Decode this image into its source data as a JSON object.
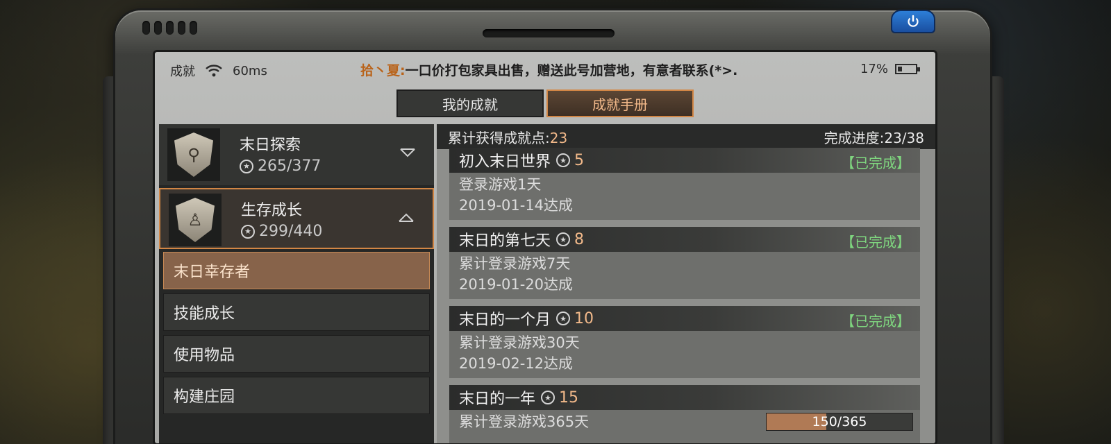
{
  "status_bar": {
    "left_label": "成就",
    "ping": "60ms",
    "broadcast_name": "拾丶夏:",
    "broadcast_text": "一口价打包家具出售，赠送此号加营地，有意者联系(*>.",
    "battery": "17%"
  },
  "tabs": [
    {
      "label": "我的成就",
      "active": false
    },
    {
      "label": "成就手册",
      "active": true
    }
  ],
  "categories": [
    {
      "title": "末日探索",
      "points": "265/377",
      "icon": "binoculars-shield-icon",
      "expanded": false
    },
    {
      "title": "生存成长",
      "points": "299/440",
      "icon": "survivor-shield-icon",
      "expanded": true
    }
  ],
  "sub_items": [
    {
      "label": "末日幸存者",
      "active": true
    },
    {
      "label": "技能成长",
      "active": false
    },
    {
      "label": "使用物品",
      "active": false
    },
    {
      "label": "构建庄园",
      "active": false
    }
  ],
  "summary": {
    "earned_label": "累计获得成就点:",
    "earned_value": "23",
    "progress_label": "完成进度:",
    "progress_value": "23/38"
  },
  "achievements": [
    {
      "title": "初入末日世界",
      "points": "5",
      "status": "【已完成】",
      "desc": "登录游戏1天",
      "date": "2019-01-14达成"
    },
    {
      "title": "末日的第七天",
      "points": "8",
      "status": "【已完成】",
      "desc": "累计登录游戏7天",
      "date": "2019-01-20达成"
    },
    {
      "title": "末日的一个月",
      "points": "10",
      "status": "【已完成】",
      "desc": "累计登录游戏30天",
      "date": "2019-02-12达成"
    },
    {
      "title": "末日的一年",
      "points": "15",
      "status": "",
      "desc": "累计登录游戏365天",
      "progress_text": "150/365",
      "progress": 0.41
    }
  ],
  "colors": {
    "accent": "#d28645",
    "points": "#f2b98a",
    "completed": "#7fd67f"
  }
}
